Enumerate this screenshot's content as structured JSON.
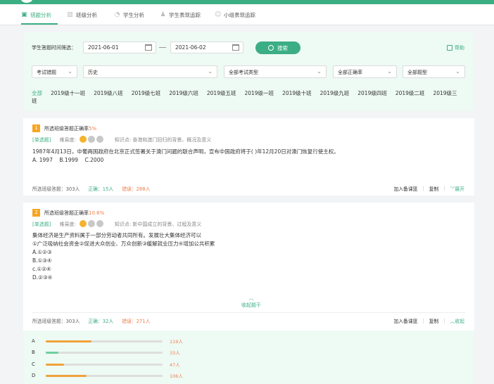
{
  "nav": {
    "items": [
      {
        "label": "错题分析",
        "icon": "error-analysis-icon",
        "active": true
      },
      {
        "label": "班级分析",
        "icon": "bar-chart-icon",
        "active": false
      },
      {
        "label": "学生分析",
        "icon": "pie-chart-icon",
        "active": false
      },
      {
        "label": "学生表现追踪",
        "icon": "student-track-icon",
        "active": false
      },
      {
        "label": "小组表现追踪",
        "icon": "group-track-icon",
        "active": false
      }
    ]
  },
  "filter": {
    "time_label": "学生答题时间筛选：",
    "start_date": "2021-06-01",
    "end_date": "2021-06-02",
    "search_label": "搜索",
    "help_label": "帮助",
    "selects": [
      {
        "value": "考试错题"
      },
      {
        "value": "历史"
      },
      {
        "value": "全部考试类型"
      },
      {
        "value": "全部正确率"
      },
      {
        "value": "全部题型"
      }
    ],
    "classes": [
      "全部",
      "2019级十一班",
      "2019级八班",
      "2019级七班",
      "2019级六班",
      "2019级五班",
      "2019级一班",
      "2019级十班",
      "2019级九班",
      "2019级四班",
      "2019级二班",
      "2019级三班"
    ]
  },
  "questions": [
    {
      "num": "1",
      "head_label": "所选班级答题正确率",
      "rate": "5%",
      "type": "[单选题]",
      "difficulty_label": "难易度:",
      "difficulty": 1,
      "difficulty_max": 3,
      "knowledge": "知识点: 香港和澳门回归的背景、概况及意义",
      "text": "1987年4月13日，中葡两国政府在北京正式签署关于澳门问题的联合声明，宣布中国政府将于(  )年12月20日对澳门恢复行使主权。",
      "options": "A. 1997    B.1999    C.2000",
      "total": "所选班级答题：303人",
      "correct": "正确：15人",
      "wrong": "错误：288人",
      "add_label": "加入备课篮",
      "copy_label": "复制",
      "toggle_label": "展开"
    },
    {
      "num": "2",
      "head_label": "所选班级答题正确率",
      "rate": "10.6%",
      "type": "[单选题]",
      "difficulty_label": "难易度:",
      "difficulty": 1,
      "difficulty_max": 3,
      "knowledge": "知识点: 新中国成立的背景、过程及意义",
      "lines": [
        "集体经济是生产资料属于一部分劳动者共同所有。发展壮大集体经济可以",
        "①广泛吸纳社会资金②促进大众创业、万众创新③缓解就业压力④增加公共积累",
        "A.①②③",
        "B.①③④",
        "c.①②④",
        "D.②③④"
      ],
      "collapse_label": "收起题干",
      "total": "所选班级答题：303人",
      "correct": "正确：32人",
      "wrong": "错误：271人",
      "add_label": "加入备课篮",
      "copy_label": "复制",
      "toggle_label": "收起"
    }
  ],
  "option_stats": [
    {
      "letter": "A",
      "count": "119人",
      "fraction": 0.39,
      "color": "#f0a23a"
    },
    {
      "letter": "B",
      "count": "33人",
      "fraction": 0.11,
      "color": "#6dcf9e"
    },
    {
      "letter": "C",
      "count": "47人",
      "fraction": 0.155,
      "color": "#f0a23a"
    },
    {
      "letter": "D",
      "count": "106人",
      "fraction": 0.35,
      "color": "#f0a23a"
    }
  ]
}
